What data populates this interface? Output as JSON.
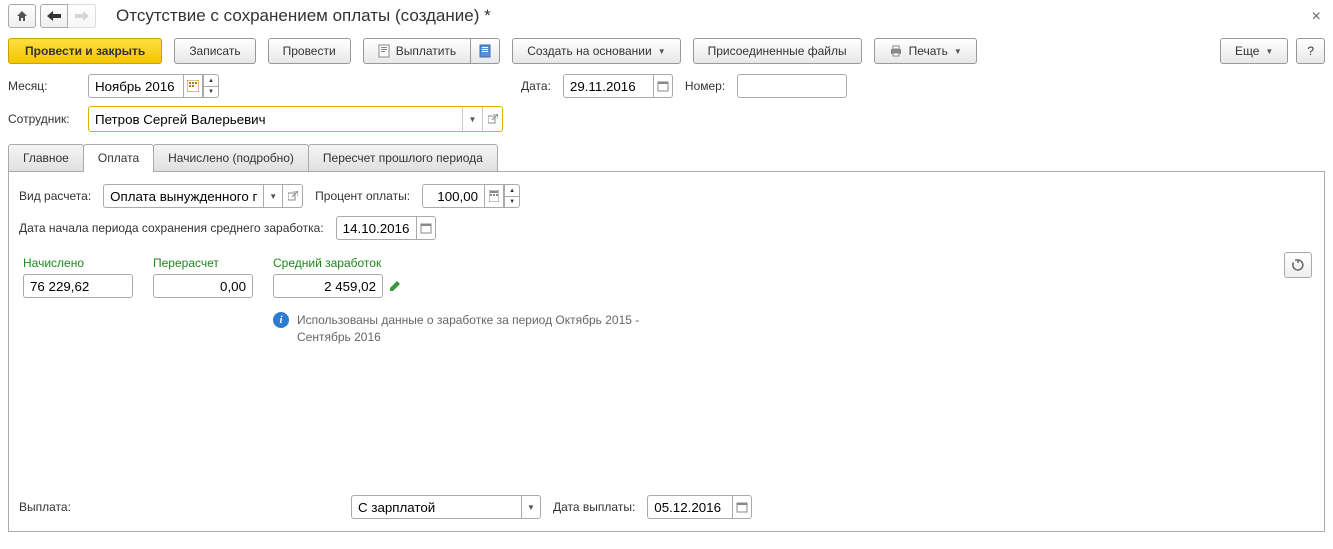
{
  "title": "Отсутствие с сохранением оплаты (создание) *",
  "toolbar": {
    "primary": "Провести и закрыть",
    "save": "Записать",
    "post": "Провести",
    "pay": "Выплатить",
    "createFrom": "Создать на основании",
    "files": "Присоединенные файлы",
    "print": "Печать",
    "more": "Еще",
    "help": "?"
  },
  "fields": {
    "monthLabel": "Месяц:",
    "month": "Ноябрь 2016",
    "dateLabel": "Дата:",
    "date": "29.11.2016",
    "numberLabel": "Номер:",
    "number": "",
    "employeeLabel": "Сотрудник:",
    "employee": "Петров Сергей Валерьевич"
  },
  "tabs": {
    "main": "Главное",
    "payment": "Оплата",
    "accrued": "Начислено (подробно)",
    "recalc": "Пересчет прошлого периода"
  },
  "payment": {
    "calcTypeLabel": "Вид расчета:",
    "calcType": "Оплата вынужденного пр",
    "percentLabel": "Процент оплаты:",
    "percent": "100,00",
    "periodStartLabel": "Дата начала периода сохранения среднего заработка:",
    "periodStart": "14.10.2016",
    "accruedLabel": "Начислено",
    "accrued": "76 229,62",
    "recalcLabel": "Перерасчет",
    "recalc": "0,00",
    "avgLabel": "Средний заработок",
    "avg": "2 459,02",
    "infoText": "Использованы данные о заработке за период Октябрь 2015 - Сентябрь 2016"
  },
  "footer": {
    "payLabel": "Выплата:",
    "payType": "С зарплатой",
    "payDateLabel": "Дата выплаты:",
    "payDate": "05.12.2016"
  }
}
